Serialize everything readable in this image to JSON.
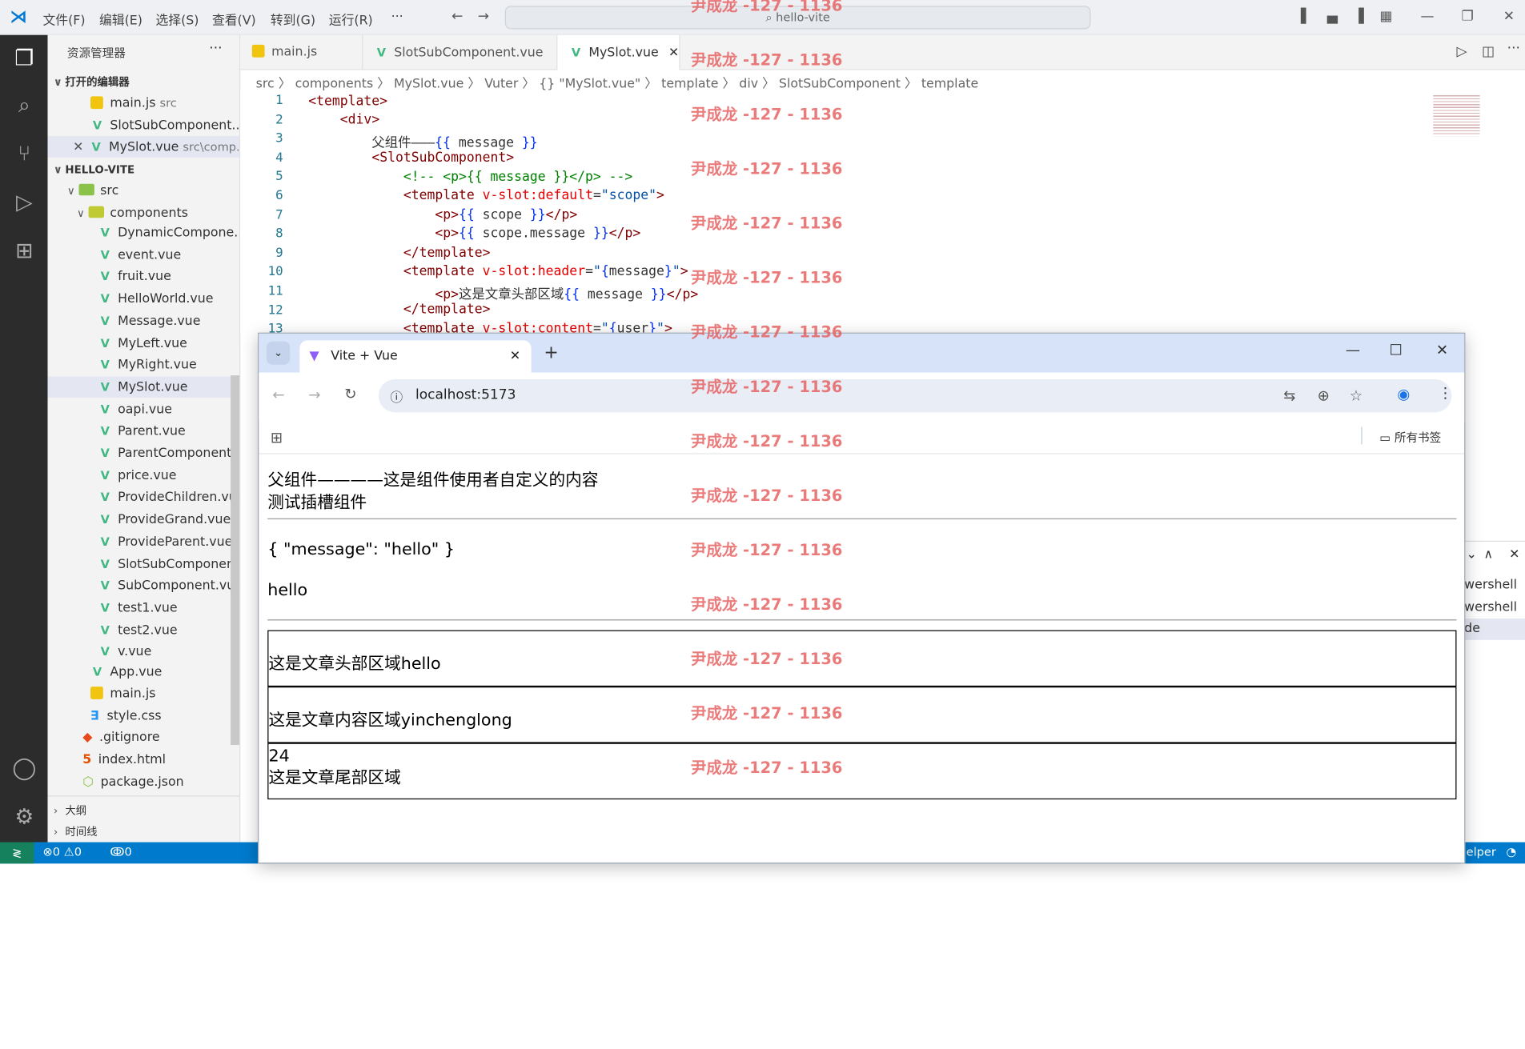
{
  "titlebar": {
    "menus": [
      "文件(F)",
      "编辑(E)",
      "选择(S)",
      "查看(V)",
      "转到(G)",
      "运行(R)",
      "···"
    ],
    "search": "hello-vite"
  },
  "sidebar": {
    "title": "资源管理器",
    "open_editors_label": "打开的编辑器",
    "open_editors": [
      {
        "name": "main.js",
        "hint": "src",
        "kind": "js"
      },
      {
        "name": "SlotSubComponent....",
        "hint": "",
        "kind": "vue"
      },
      {
        "name": "MySlot.vue",
        "hint": "src\\comp...",
        "kind": "vue"
      }
    ],
    "project_label": "HELLO-VITE",
    "src_label": "src",
    "components_label": "components",
    "components": [
      "DynamicCompone...",
      "event.vue",
      "fruit.vue",
      "HelloWorld.vue",
      "Message.vue",
      "MyLeft.vue",
      "MyRight.vue",
      "MySlot.vue",
      "oapi.vue",
      "Parent.vue",
      "ParentComponent...",
      "price.vue",
      "ProvideChildren.vue",
      "ProvideGrand.vue",
      "ProvideParent.vue",
      "SlotSubComponen...",
      "SubComponent.vue",
      "test1.vue",
      "test2.vue",
      "v.vue"
    ],
    "src_files": [
      "App.vue",
      "main.js",
      "style.css"
    ],
    "root_files": [
      ".gitignore",
      "index.html",
      "package.json"
    ],
    "outline_label": "大纲",
    "timeline_label": "时间线"
  },
  "editor": {
    "tabs": [
      "main.js",
      "SlotSubComponent.vue",
      "MySlot.vue"
    ],
    "breadcrumb": "src 〉 components 〉 MySlot.vue 〉 Vuter 〉 {} \"MySlot.vue\" 〉 template 〉 div 〉 SlotSubComponent 〉 template",
    "line_numbers": [
      "1",
      "2",
      "3",
      "4",
      "5",
      "6",
      "7",
      "8",
      "9",
      "10",
      "11",
      "12",
      "13"
    ]
  },
  "status": {
    "errors": "0",
    "warnings": "0",
    "ports": "0",
    "right": "elper"
  },
  "right_panel": [
    "wershell",
    "wershell",
    "de"
  ],
  "browser": {
    "tab_title": "Vite + Vue",
    "url": "localhost:5173",
    "bookmarks": "所有书签",
    "line1": "父组件————这是组件使用者自定义的内容",
    "line2": "测试插槽组件",
    "scope_json": "{ \"message\": \"hello\" }",
    "scope_msg": "hello",
    "header_text": "这是文章头部区域hello",
    "content_text": "这是文章内容区域yinchenglong",
    "footer_num": "24",
    "footer_text": "这是文章尾部区域"
  },
  "watermark": "尹成龙 -127 - 1136"
}
